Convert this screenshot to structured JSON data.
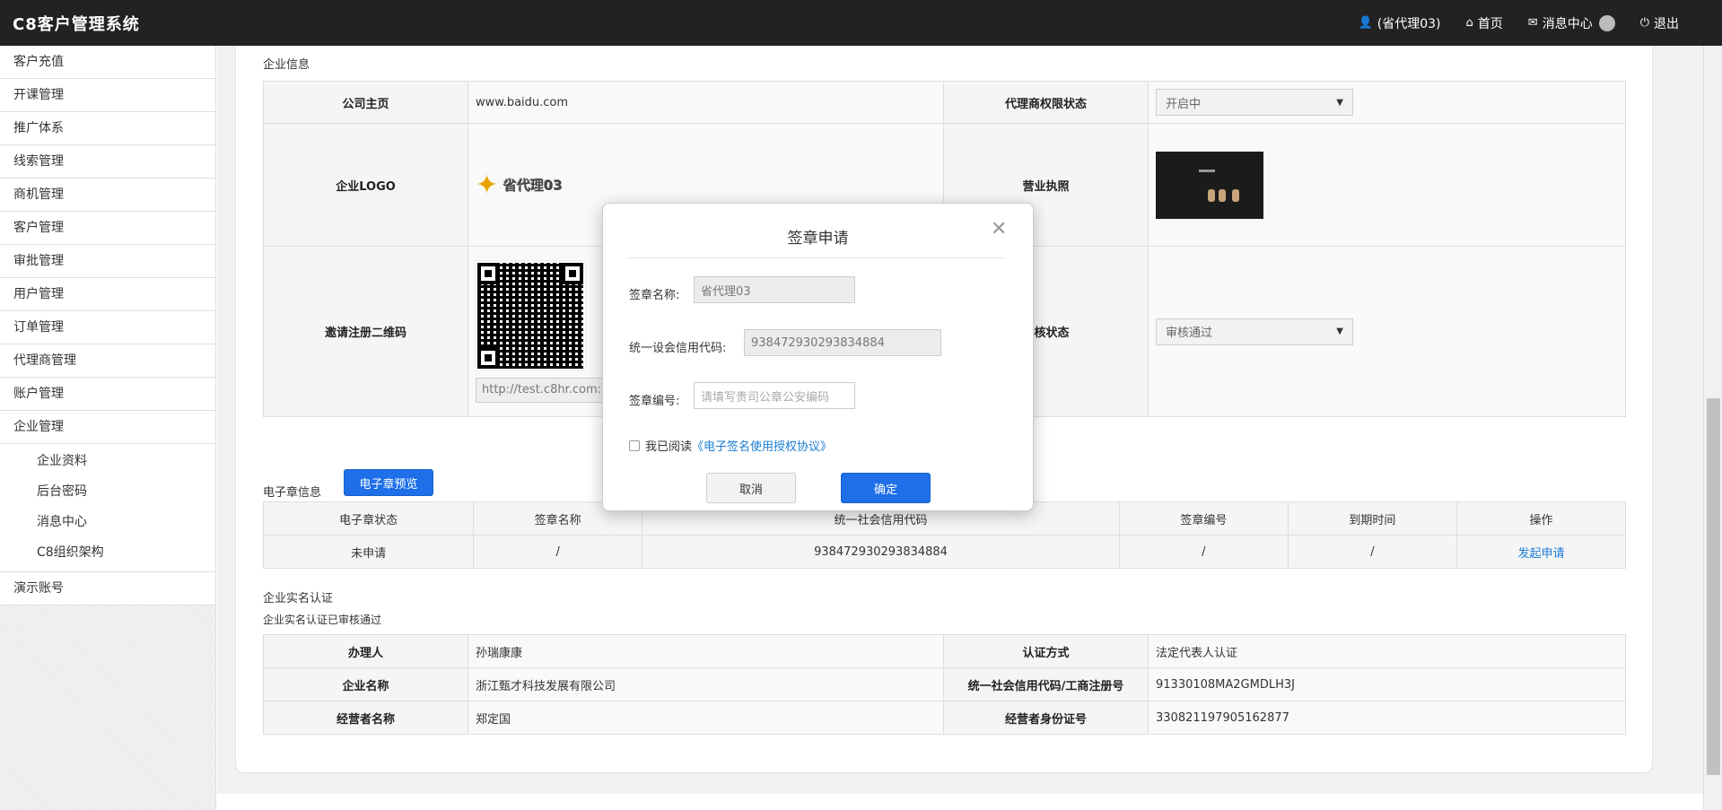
{
  "header": {
    "brand": "C8客户管理系统",
    "user": "(省代理03)",
    "home": "首页",
    "messages": "消息中心",
    "logout": "退出"
  },
  "sidebar": {
    "items": [
      "客户充值",
      "开课管理",
      "推广体系",
      "线索管理",
      "商机管理",
      "客户管理",
      "审批管理",
      "用户管理",
      "订单管理",
      "代理商管理",
      "账户管理",
      "企业管理"
    ],
    "sub_items": [
      "企业资料",
      "后台密码",
      "消息中心",
      "C8组织架构"
    ],
    "last_item": "演示账号"
  },
  "company": {
    "section_title": "企业信息",
    "homepage_label": "公司主页",
    "homepage_value": "www.baidu.com",
    "agent_status_label": "代理商权限状态",
    "agent_status_value": "开启中",
    "logo_label": "企业LOGO",
    "logo_text": "省代理03",
    "license_label": "营业执照",
    "qr_label": "邀请注册二维码",
    "qr_url": "http://test.c8hr.com:80",
    "audit_label": "审核状态",
    "audit_value": "审核通过"
  },
  "seal": {
    "section_title": "电子章信息",
    "preview_button": "电子章预览",
    "columns": [
      "电子章状态",
      "签章名称",
      "统一社会信用代码",
      "签章编号",
      "到期时间",
      "操作"
    ],
    "row": {
      "status": "未申请",
      "name": "/",
      "credit_code": "938472930293834884",
      "seal_no": "/",
      "expire": "/",
      "action": "发起申请"
    }
  },
  "realname": {
    "section_title": "企业实名认证",
    "subtitle": "企业实名认证已审核通过",
    "rows": [
      {
        "l1": "办理人",
        "v1": "孙瑞康康",
        "l2": "认证方式",
        "v2": "法定代表人认证"
      },
      {
        "l1": "企业名称",
        "v1": "浙江甄才科技发展有限公司",
        "l2": "统一社会信用代码/工商注册号",
        "v2": "91330108MA2GMDLH3J"
      },
      {
        "l1": "经营者名称",
        "v1": "郑定国",
        "l2": "经营者身份证号",
        "v2": "330821197905162877"
      }
    ]
  },
  "modal": {
    "title": "签章申请",
    "name_label": "签章名称:",
    "name_value": "省代理03",
    "credit_label": "统一设会信用代码:",
    "credit_value": "938472930293834884",
    "seal_no_label": "签章编号:",
    "seal_no_placeholder": "请填写贵司公章公安编码",
    "agree_prefix": "我已阅读",
    "agree_link": "《电子签名使用授权协议》",
    "cancel": "取消",
    "confirm": "确定"
  }
}
